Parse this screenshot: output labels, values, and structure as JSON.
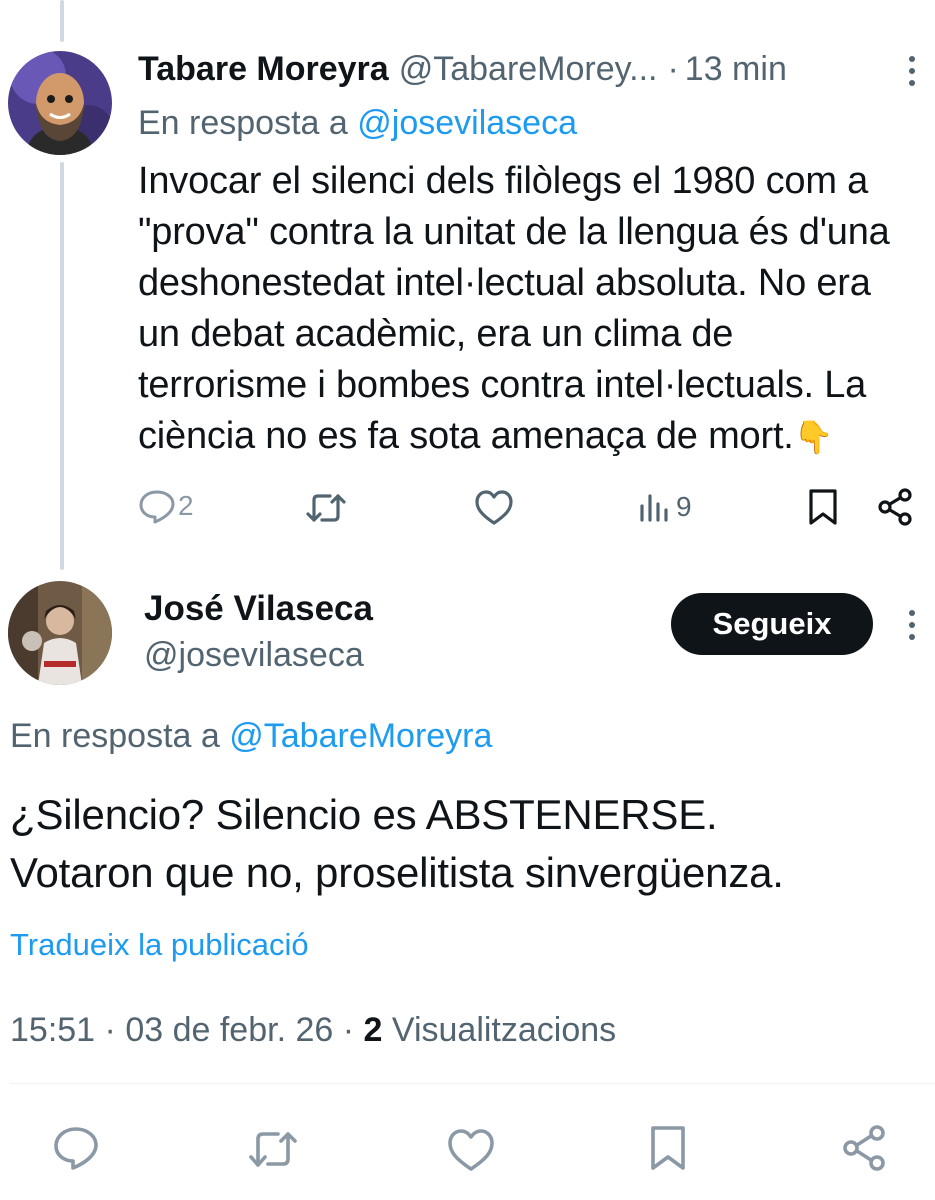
{
  "reply_tweet": {
    "author_name": "Tabare Moreyra",
    "author_handle": "@TabareMorey...",
    "separator": "·",
    "time_ago": "13 min",
    "reply_prefix": "En resposta a",
    "reply_to": "@josevilaseca",
    "text_lines": [
      "Invocar el silenci dels filòlegs el 1980 com a",
      "\"prova\" contra la unitat de la llengua és d'una",
      "deshonestedat intel·lectual absoluta. No era",
      "un debat acadèmic, era un clima de",
      "terrorisme i bombes contra intel·lectuals. La",
      "ciència no es fa sota amenaça de mort."
    ],
    "emoji": "👇",
    "actions": {
      "reply_count": "2",
      "views_count": "9"
    }
  },
  "main_tweet": {
    "author_name": "José Vilaseca",
    "author_handle": "@josevilaseca",
    "follow_label": "Segueix",
    "reply_prefix": "En resposta a",
    "reply_to": "@TabareMoreyra",
    "text_lines": [
      "¿Silencio? Silencio es ABSTENERSE.",
      "Votaron que no, proselitista sinvergüenza."
    ],
    "translate_label": "Tradueix la publicació",
    "time": "15:51",
    "dot1": "·",
    "date": "03 de febr. 26",
    "dot2": "·",
    "views_count": "2",
    "views_label": "Visualitzacions"
  },
  "colors": {
    "accent": "#1d9bf0",
    "muted": "#536471",
    "text": "#0f1419",
    "thread_line": "#cfd9de"
  },
  "icons": {
    "reply": "speech-bubble-icon",
    "retweet": "retweet-icon",
    "like": "heart-icon",
    "views": "bar-chart-icon",
    "bookmark": "bookmark-icon",
    "share": "share-icon",
    "more": "vertical-dots-icon"
  }
}
